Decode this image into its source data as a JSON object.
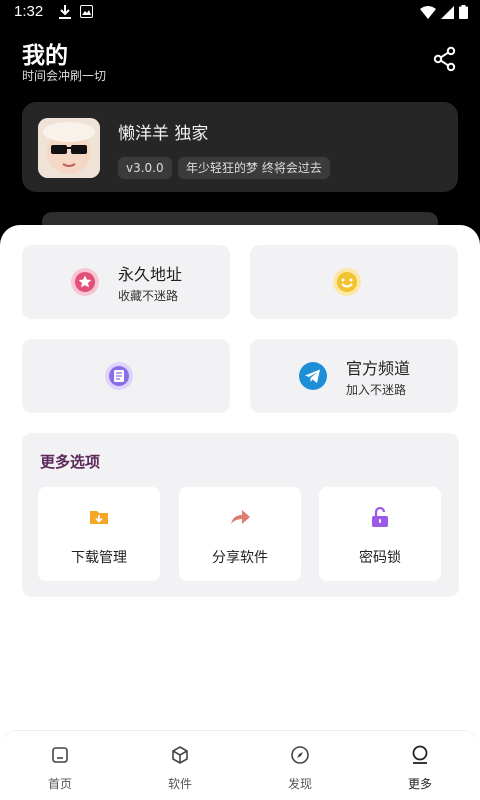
{
  "status_bar": {
    "time": "1:32"
  },
  "header": {
    "title": "我的",
    "subtitle": "时间会冲刷一切"
  },
  "profile": {
    "name": "懒洋羊 独家",
    "version": "v3.0.0",
    "motto": "年少轻狂的梦 终将会过去"
  },
  "tiles": [
    {
      "title": "永久地址",
      "subtitle": "收藏不迷路",
      "icon": "star-icon",
      "color": "#e2507a"
    },
    {
      "title": "",
      "subtitle": "",
      "icon": "smile-icon",
      "color": "#f2c230"
    },
    {
      "title": "",
      "subtitle": "",
      "icon": "document-icon",
      "color": "#8a6ee6"
    },
    {
      "title": "官方频道",
      "subtitle": "加入不迷路",
      "icon": "telegram-icon",
      "color": "#1e8fd6"
    }
  ],
  "more": {
    "title": "更多选项",
    "items": [
      {
        "label": "下载管理",
        "icon": "download-folder-icon",
        "color": "#f5a623"
      },
      {
        "label": "分享软件",
        "icon": "share-arrow-icon",
        "color": "#e07a73"
      },
      {
        "label": "密码锁",
        "icon": "unlock-icon",
        "color": "#9b59e8"
      }
    ]
  },
  "nav": {
    "items": [
      {
        "label": "首页",
        "icon": "home-icon"
      },
      {
        "label": "软件",
        "icon": "cube-icon"
      },
      {
        "label": "发现",
        "icon": "compass-icon"
      },
      {
        "label": "更多",
        "icon": "user-icon"
      }
    ],
    "active": "更多"
  }
}
